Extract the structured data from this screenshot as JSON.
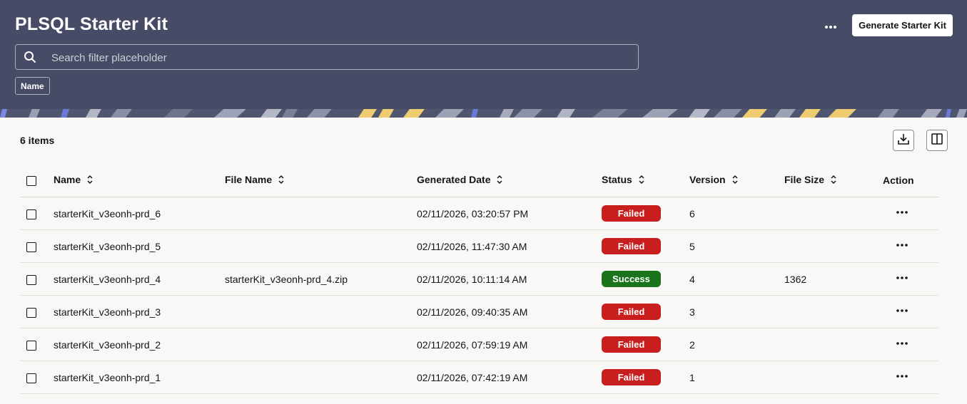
{
  "header": {
    "title": "PLSQL Starter Kit",
    "more_icon": "more-horizontal-icon",
    "generate_label": "Generate Starter Kit",
    "search_placeholder": "Search filter placeholder",
    "filter_chip": "Name",
    "colors": {
      "background": "#474c66",
      "banner_yellow": "#f0cc71",
      "banner_blue": "#6b7ad8"
    }
  },
  "toolbar": {
    "items_count": "6 items",
    "download_icon": "download-icon",
    "columns_icon": "column-panel-icon"
  },
  "table": {
    "columns": [
      "Name",
      "File Name",
      "Generated Date",
      "Status",
      "Version",
      "File Size",
      "Action"
    ],
    "rows": [
      {
        "name": "starterKit_v3eonh-prd_6",
        "file_name": "",
        "date": "02/11/2026, 03:20:57 PM",
        "status": "Failed",
        "version": "6",
        "file_size": ""
      },
      {
        "name": "starterKit_v3eonh-prd_5",
        "file_name": "",
        "date": "02/11/2026, 11:47:30 AM",
        "status": "Failed",
        "version": "5",
        "file_size": ""
      },
      {
        "name": "starterKit_v3eonh-prd_4",
        "file_name": "starterKit_v3eonh-prd_4.zip",
        "date": "02/11/2026, 10:11:14 AM",
        "status": "Success",
        "version": "4",
        "file_size": "1362"
      },
      {
        "name": "starterKit_v3eonh-prd_3",
        "file_name": "",
        "date": "02/11/2026, 09:40:35 AM",
        "status": "Failed",
        "version": "3",
        "file_size": ""
      },
      {
        "name": "starterKit_v3eonh-prd_2",
        "file_name": "",
        "date": "02/11/2026, 07:59:19 AM",
        "status": "Failed",
        "version": "2",
        "file_size": ""
      },
      {
        "name": "starterKit_v3eonh-prd_1",
        "file_name": "",
        "date": "02/11/2026, 07:42:19 AM",
        "status": "Failed",
        "version": "1",
        "file_size": ""
      }
    ],
    "status_colors": {
      "Failed": "#c91e1e",
      "Success": "#19741c"
    },
    "action_icon": "more-horizontal-icon"
  }
}
